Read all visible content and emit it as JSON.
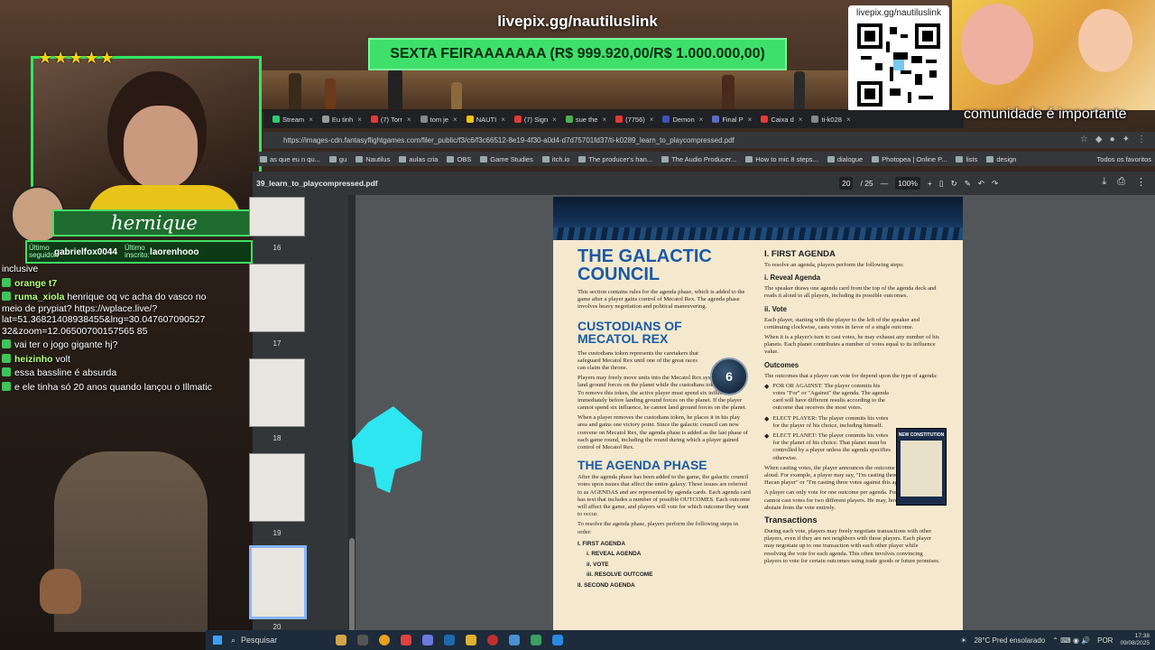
{
  "overlay": {
    "live_url": "livepix.gg/nautiluslink",
    "goal_text": "SEXTA FEIRAAAAAAA (R$ 999.920,00/R$ 1.000.000,00)",
    "qr_label": "livepix.gg/nautiluslink",
    "comic_caption": "comunidade é importante",
    "streamer_name": "hernique",
    "stars": "★★★★★",
    "last_follower_label": "Último seguidor:",
    "last_follower": "gabrielfox0044",
    "last_sub_label": "Último inscrito:",
    "last_sub": "laorenhooo"
  },
  "chat": [
    {
      "user": "",
      "text": "inclusive"
    },
    {
      "user": "orange t7",
      "text": ""
    },
    {
      "user": "ruma_xiola",
      "text": "henrique oq vc acha do vasco no meio de prypiat? https://wplace.live/?lat=51.36821408938455&lng=30.047607090527 32&zoom=12.06500700157565 85"
    },
    {
      "user": "",
      "text": "vai ter o jogo gigante hj?"
    },
    {
      "user": "heizinho",
      "text": "volt"
    },
    {
      "user": "",
      "text": "essa bassline é absurda"
    },
    {
      "user": "",
      "text": ""
    },
    {
      "user": "",
      "text": "e ele tinha só 20 anos quando lançou o Illmatic"
    }
  ],
  "browser": {
    "tabs": [
      {
        "label": "Stream",
        "color": "#2ecc71"
      },
      {
        "label": "Eu tinh",
        "color": "#999"
      },
      {
        "label": "(7) Torr",
        "color": "#e53935"
      },
      {
        "label": "tom je",
        "color": "#888"
      },
      {
        "label": "NAUTI",
        "color": "#f1c40f"
      },
      {
        "label": "(7) Sign",
        "color": "#e53935"
      },
      {
        "label": "sue the",
        "color": "#4caf50"
      },
      {
        "label": "(7756)",
        "color": "#e53935"
      },
      {
        "label": "Demon",
        "color": "#3f51b5"
      },
      {
        "label": "Final P",
        "color": "#5c6bc0"
      },
      {
        "label": "Caixa d",
        "color": "#e53935"
      },
      {
        "label": "ti-k028",
        "color": "#888"
      }
    ],
    "url": "https://images-cdn.fantasyflightgames.com/filer_public/f3/c6/f3c66512-8e19-4f30-a0d4-d7d75701fd37/ti-k0289_learn_to_playcompressed.pdf",
    "bookmarks": [
      "as que eu n qu...",
      "gu",
      "Nautilus",
      "aulas cria",
      "OBS",
      "Game Studies",
      "itch.io",
      "The producer's han...",
      "The Audio Producer...",
      "How to mic 8 steps...",
      "dialogue",
      "Photopea | Online P...",
      "lists",
      "design"
    ],
    "bookmarks_right": "Todos os favoritos"
  },
  "pdf": {
    "filename": "39_learn_to_playcompressed.pdf",
    "page_current": "20",
    "page_total": "/ 25",
    "zoom": "100%",
    "thumbs": [
      "16",
      "17",
      "18",
      "19",
      "20"
    ],
    "title": "THE GALACTIC COUNCIL",
    "intro": "This section contains rules for the agenda phase, which is added to the game after a player gains control of Mecatol Rex. The agenda phase involves heavy negotiation and political maneuvering.",
    "custodians_title": "CUSTODIANS OF MECATOL REX",
    "custodians_p1": "The custodians token represents the caretakers that safeguard Mecatol Rex until one of the great races can claim the throne.",
    "custodians_p2": "Players may freely move units into the Mecatol Rex system, but cannot land ground forces on the planet while the custodians token is present. To remove this token, the active player must spend six influence immediately before landing ground forces on the planet. If the player cannot spend six influence, he cannot land ground forces on the planet.",
    "custodians_p3": "When a player removes the custodians token, he places it in his play area and gains one victory point. Since the galactic council can now convene on Mecatol Rex, the agenda phase is added as the last phase of each game round, including the round during which a player gained control of Mecatol Rex.",
    "token_value": "6",
    "agenda_title": "THE AGENDA PHASE",
    "agenda_p1": "After the agenda phase has been added to the game, the galactic council votes upon issues that affect the entire galaxy. These issues are referred to as AGENDAS and are represented by agenda cards. Each agenda card has text that includes a number of possible OUTCOMES. Each outcome will affect the game, and players will vote for which outcome they want to occur.",
    "agenda_p2": "To resolve the agenda phase, players perform the following steps in order:",
    "steps": [
      "I.   FIRST AGENDA",
      "i.   REVEAL AGENDA",
      "ii.  VOTE",
      "iii. RESOLVE OUTCOME",
      "II.  SECOND AGENDA"
    ],
    "first_agenda_title": "I. FIRST AGENDA",
    "first_agenda_p": "To resolve an agenda, players perform the following steps:",
    "reveal_title": "i. Reveal Agenda",
    "reveal_p": "The speaker draws one agenda card from the top of the agenda deck and reads it aloud to all players, including its possible outcomes.",
    "vote_title": "ii. Vote",
    "vote_p1": "Each player, starting with the player to the left of the speaker and continuing clockwise, casts votes in favor of a single outcome.",
    "vote_p2": "When it is a player's turn to cast votes, he may exhaust any number of his planets. Each planet contributes a number of votes equal to its influence value.",
    "outcomes_title": "Outcomes",
    "outcomes_p": "The outcomes that a player can vote for depend upon the type of agenda:",
    "bullets": [
      "FOR OR AGAINST: The player commits his votes \"For\" or \"Against\" the agenda. The agenda card will have different results according to the outcome that receives the most votes.",
      "ELECT PLAYER: The player commits his votes for the player of his choice, including himself.",
      "ELECT PLANET: The player commits his votes for the planet of his choice. That planet must be controlled by a player unless the agenda specifies otherwise."
    ],
    "card_title": "NEW CONSTITUTION",
    "casting_p": "When casting votes, the player announces the outcome he is voting for aloud. For example, a player may say, \"I'm casting three votes to elect the Hacan player\" or \"I'm casting three votes against this agenda.\"",
    "one_outcome_p": "A player can only vote for one outcome per agenda. For example, he cannot cast votes for two different players. He may, however, choose to abstain from the vote entirely.",
    "transactions_title": "Transactions",
    "transactions_p": "During each vote, players may freely negotiate transactions with other players, even if they are not neighbors with those players. Each player may negotiate up to one transaction with each other player while resolving the vote for each agenda. This often involves convincing players to vote for certain outcomes using trade goods or future promises."
  },
  "taskbar": {
    "search": "Pesquisar",
    "weather": "28°C  Pred ensolarado",
    "lang": "POR",
    "time": "17:38",
    "date": "09/08/2025"
  },
  "colors": {
    "accent_green": "#3ee06a",
    "pdf_heading_blue": "#1b5aa6"
  }
}
